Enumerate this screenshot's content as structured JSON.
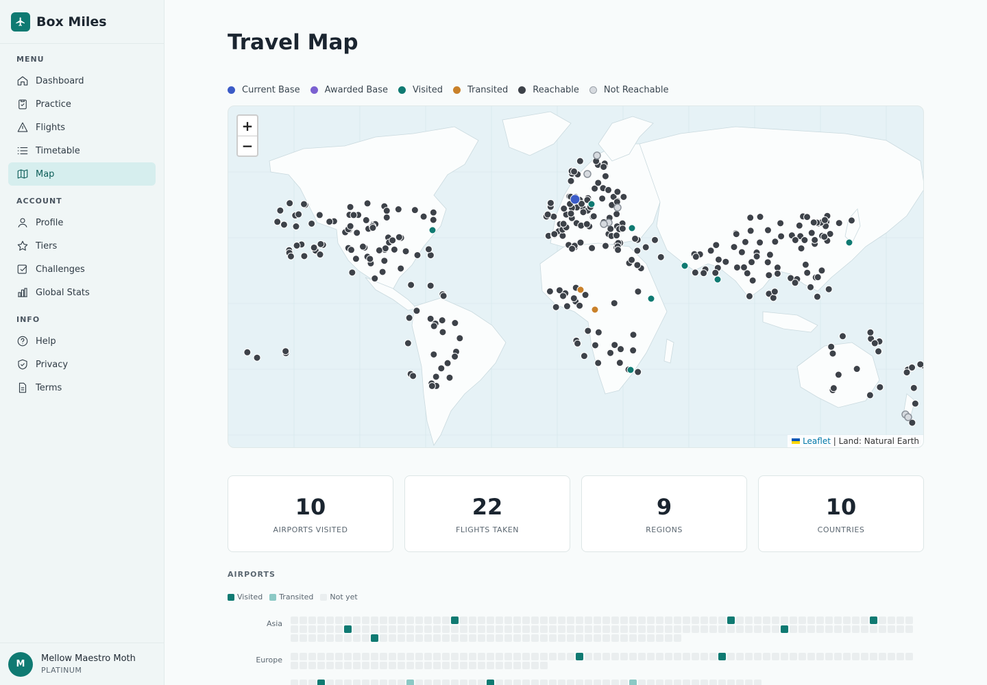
{
  "app": {
    "name": "Box Miles"
  },
  "sidebar": {
    "sections": [
      {
        "heading": "MENU",
        "items": [
          {
            "label": "Dashboard",
            "icon": "home-icon"
          },
          {
            "label": "Practice",
            "icon": "clipboard-icon"
          },
          {
            "label": "Flights",
            "icon": "triangle-icon"
          },
          {
            "label": "Timetable",
            "icon": "list-icon"
          },
          {
            "label": "Map",
            "icon": "map-icon",
            "active": true
          }
        ]
      },
      {
        "heading": "ACCOUNT",
        "items": [
          {
            "label": "Profile",
            "icon": "user-icon"
          },
          {
            "label": "Tiers",
            "icon": "star-icon"
          },
          {
            "label": "Challenges",
            "icon": "checkbox-icon"
          },
          {
            "label": "Global Stats",
            "icon": "bar-chart-icon"
          }
        ]
      },
      {
        "heading": "INFO",
        "items": [
          {
            "label": "Help",
            "icon": "help-circle-icon"
          },
          {
            "label": "Privacy",
            "icon": "shield-icon"
          },
          {
            "label": "Terms",
            "icon": "document-icon"
          }
        ]
      }
    ],
    "user": {
      "initial": "M",
      "name": "Mellow Maestro Moth",
      "tier": "PLATINUM"
    }
  },
  "page": {
    "title": "Travel Map"
  },
  "map_legend": [
    {
      "label": "Current Base",
      "color": "#3b5bc7"
    },
    {
      "label": "Awarded Base",
      "color": "#7b61d1"
    },
    {
      "label": "Visited",
      "color": "#0f7a72"
    },
    {
      "label": "Transited",
      "color": "#c9812a"
    },
    {
      "label": "Reachable",
      "color": "#3d4249"
    },
    {
      "label": "Not Reachable",
      "color": "#d6dadf"
    }
  ],
  "map": {
    "zoom_in": "+",
    "zoom_out": "−",
    "attribution_link": "Leaflet",
    "attribution_text": "| Land: Natural Earth",
    "colors": {
      "water": "#e6f2f6",
      "land": "#fbfdfd"
    }
  },
  "stats": [
    {
      "value": "10",
      "label": "AIRPORTS VISITED"
    },
    {
      "value": "22",
      "label": "FLIGHTS TAKEN"
    },
    {
      "value": "9",
      "label": "REGIONS"
    },
    {
      "value": "10",
      "label": "COUNTRIES"
    }
  ],
  "airports": {
    "heading": "AIRPORTS",
    "legend": [
      {
        "label": "Visited",
        "color": "#0f7a72"
      },
      {
        "label": "Transited",
        "color": "#8cc9c5"
      },
      {
        "label": "Not yet",
        "color": "#eaeeef"
      }
    ],
    "regions": [
      {
        "name": "Asia"
      },
      {
        "name": "Europe"
      }
    ]
  }
}
